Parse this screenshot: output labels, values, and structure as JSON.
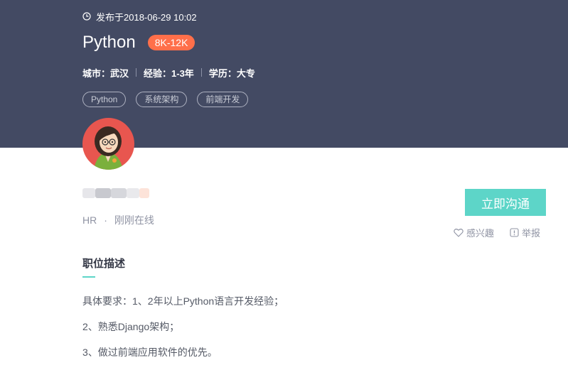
{
  "header": {
    "publish_text": "发布于2018-06-29 10:02",
    "job_title": "Python",
    "salary": "8K-12K",
    "meta": [
      "城市：武汉",
      "经验：1-3年",
      "学历：大专"
    ],
    "tags": [
      "Python",
      "系统架构",
      "前端开发"
    ]
  },
  "recruiter": {
    "role": "HR",
    "separator": "·",
    "status": "刚刚在线"
  },
  "actions": {
    "chat_button": "立即沟通",
    "interest": "感兴趣",
    "report": "举报"
  },
  "description": {
    "title": "职位描述",
    "lines": [
      "具体要求：1、2年以上Python语言开发经验；",
      "2、熟悉Django架构；",
      "3、做过前端应用软件的优先。"
    ]
  },
  "colors": {
    "header_bg": "#434a63",
    "salary_badge": "#ff6f4a",
    "accent": "#5dd5c8"
  },
  "icons": [
    "clock-icon",
    "heart-icon",
    "report-icon"
  ]
}
